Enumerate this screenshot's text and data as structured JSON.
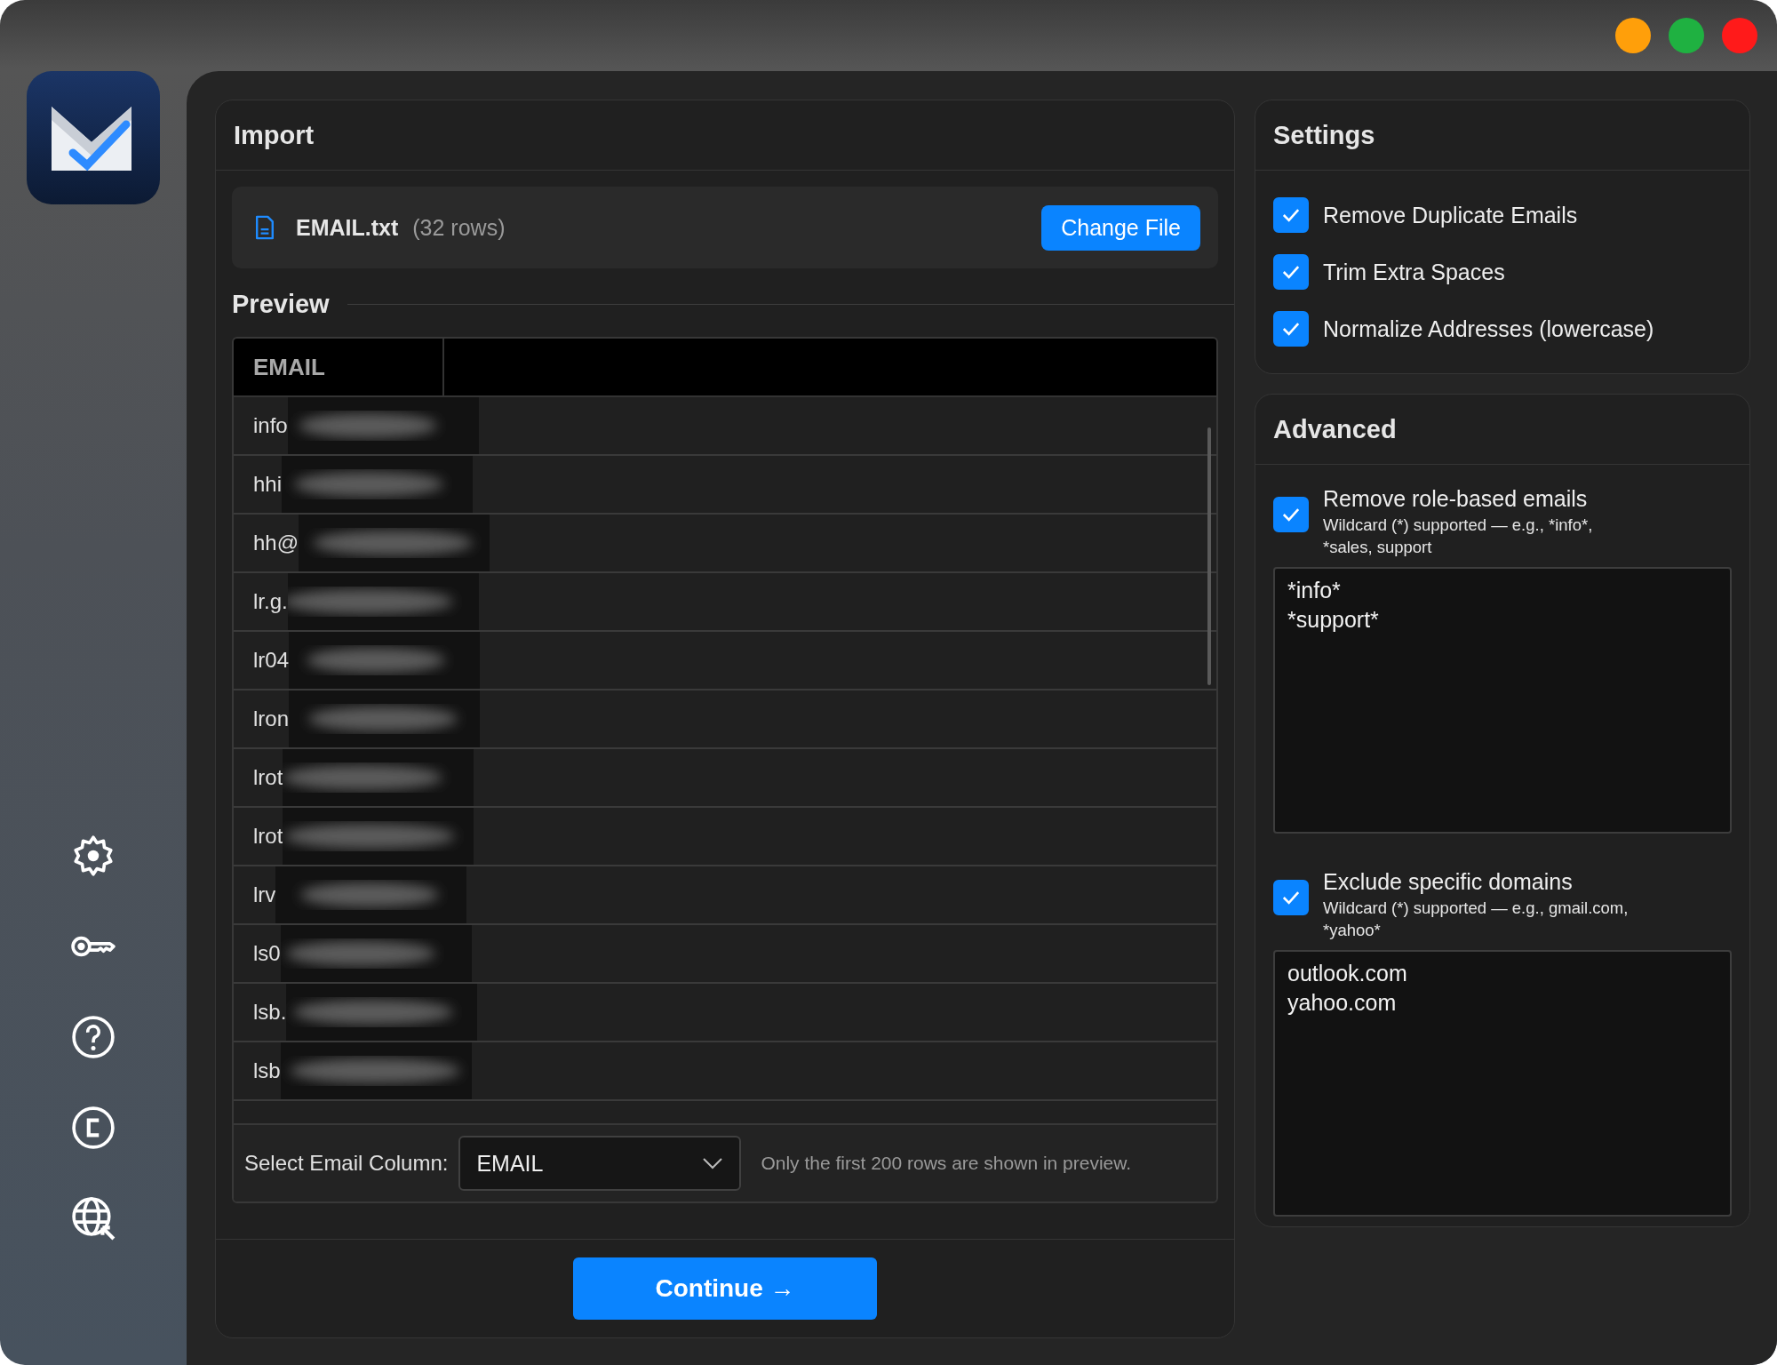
{
  "window": {
    "controls": [
      {
        "color": "#ff9f0a"
      },
      {
        "color": "#1fb141"
      },
      {
        "color": "#ff1a1a"
      }
    ]
  },
  "import": {
    "title": "Import",
    "file_name": "EMAIL.txt",
    "file_rows": "(32 rows)",
    "change_button": "Change File",
    "preview": {
      "title": "Preview",
      "columns": [
        "EMAIL"
      ],
      "rows": [
        "info",
        "hhi",
        "hh@",
        "lr.g.",
        "lr04",
        "lron",
        "lrot",
        "lrot",
        "lrv",
        "ls0",
        "lsb.",
        "lsb"
      ],
      "column_label": "Select Email Column:",
      "column_select": "EMAIL",
      "note": "Only the first 200 rows are shown in preview."
    },
    "continue_button": "Continue →"
  },
  "settings": {
    "title": "Settings",
    "options": [
      {
        "label": "Remove Duplicate Emails",
        "checked": true
      },
      {
        "label": "Trim Extra Spaces",
        "checked": true
      },
      {
        "label": "Normalize Addresses (lowercase)",
        "checked": true
      }
    ]
  },
  "advanced": {
    "title": "Advanced",
    "filters": [
      {
        "label": "Remove role-based emails",
        "hint": "Wildcard (*) supported — e.g., *info*, *sales, support",
        "checked": true,
        "value": "*info*\n*support*"
      },
      {
        "label": "Exclude specific domains",
        "hint": "Wildcard (*) supported — e.g., gmail.com, *yahoo*",
        "checked": true,
        "value": "outlook.com\nyahoo.com"
      }
    ]
  }
}
